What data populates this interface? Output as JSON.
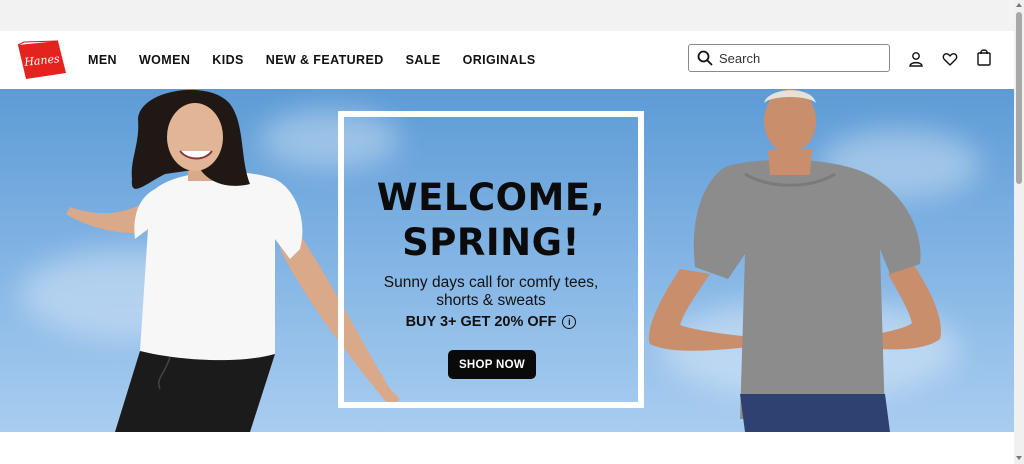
{
  "brand": {
    "logo_text": "Hanes",
    "color": "#e4231f"
  },
  "nav": {
    "items": [
      "MEN",
      "WOMEN",
      "KIDS",
      "NEW & FEATURED",
      "SALE",
      "ORIGINALS"
    ]
  },
  "search": {
    "placeholder": "Search",
    "icon": "search-icon"
  },
  "header_icons": [
    "account-icon",
    "heart-icon",
    "bag-icon"
  ],
  "hero": {
    "title_line1": "WELCOME,",
    "title_line2": "SPRING!",
    "subtitle_line1": "Sunny days call for comfy tees,",
    "subtitle_line2": "shorts & sweats",
    "offer": "BUY 3+ GET 20% OFF",
    "info_glyph": "i",
    "cta": "SHOP NOW"
  },
  "colors": {
    "sky_top": "#5d9bd6",
    "sky_bottom": "#a9cdf0",
    "cta_bg": "#0a0a0a"
  }
}
